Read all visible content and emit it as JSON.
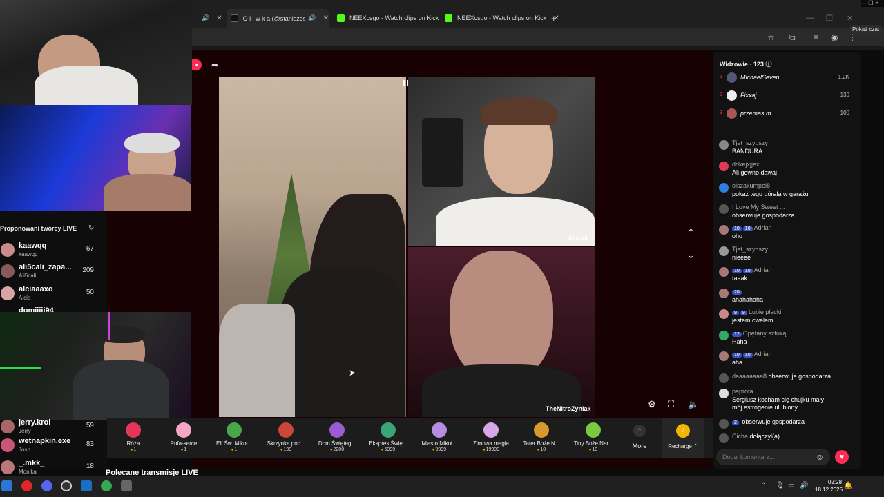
{
  "browser": {
    "tabs": [
      {
        "label": "O l i w k a (@staniszesia_)",
        "active": true
      },
      {
        "label": "NEEXcsgo - Watch clips on Kick",
        "active": false
      },
      {
        "label": "NEEXcsgo - Watch clips on Kick",
        "active": false
      }
    ],
    "show_chat_tooltip": "Pokaż czat"
  },
  "sidebar": {
    "title": "Proponowani twórcy LIVE",
    "creators": [
      {
        "name": "kaawqq",
        "sub": "kaawqq",
        "count": "67"
      },
      {
        "name": "ali5cali_zapa...",
        "sub": "Ali5cali",
        "count": "209"
      },
      {
        "name": "alciaaaxo",
        "sub": "Alcia",
        "count": "50"
      },
      {
        "name": "domiiiii94",
        "sub": "",
        "count": ""
      },
      {
        "name": "jerry.krol",
        "sub": "Jerry",
        "count": "59"
      },
      {
        "name": "wetnapkin.exe",
        "sub": "Josh",
        "count": "83"
      },
      {
        "name": "_.mkk_",
        "sub": "Monika",
        "count": "18"
      }
    ]
  },
  "video": {
    "tr_label": "Aliscali",
    "br_label": "TheNitroZyniak"
  },
  "gifts": [
    {
      "name": "Róża",
      "price": "1",
      "color": "#e7345a"
    },
    {
      "name": "Pufa-serce",
      "price": "1",
      "color": "#f4a7c6"
    },
    {
      "name": "Elf Św. Mikoł...",
      "price": "1",
      "color": "#49a649"
    },
    {
      "name": "Skrzynka poc...",
      "price": "199",
      "color": "#c9483a"
    },
    {
      "name": "Dom Święteg...",
      "price": "2200",
      "color": "#9b5bd4"
    },
    {
      "name": "Ekspres Świę...",
      "price": "5999",
      "color": "#3aa577"
    },
    {
      "name": "Miasto Mikoł...",
      "price": "9999",
      "color": "#b68de0"
    },
    {
      "name": "Zimowa magia",
      "price": "19999",
      "color": "#d8a7e8"
    },
    {
      "name": "Tater Boże N...",
      "price": "10",
      "color": "#d89a2e"
    },
    {
      "name": "Tiny Boże Nar...",
      "price": "10",
      "color": "#7ac943"
    }
  ],
  "controls": {
    "more": "More",
    "recharge": "Recharge"
  },
  "recommended_title": "Polecane transmisje LIVE",
  "chat": {
    "viewers_title": "Widzowie · 123",
    "top_viewers": [
      {
        "rank": "1",
        "name": "MichaelSeven",
        "score": "1.2K"
      },
      {
        "rank": "2",
        "name": "Fixxaj",
        "score": "139"
      },
      {
        "rank": "3",
        "name": "przemas.m",
        "score": "100"
      }
    ],
    "messages": [
      {
        "user": "Tjet_szybszy",
        "badges": [],
        "text": "BANDURA"
      },
      {
        "user": "ddkejxjjex",
        "badges": [],
        "text": "Ali gowno dawaj"
      },
      {
        "user": "olszakumpel8",
        "badges": [],
        "text": "pokaż tego górala w garażu"
      },
      {
        "user": "I Love My Sweet ...",
        "badges": [],
        "text": "obserwuje gospodarza"
      },
      {
        "user": "Adrian",
        "badges": [
          "10",
          "10"
        ],
        "text": "oho"
      },
      {
        "user": "Tjet_szybszy",
        "badges": [],
        "text": "nieeee"
      },
      {
        "user": "Adrian",
        "badges": [
          "10",
          "10"
        ],
        "text": "taaak"
      },
      {
        "user": "",
        "badges": [
          "20"
        ],
        "text": "ahahahaha"
      },
      {
        "user": "Lubie placki",
        "badges": [
          "9",
          "9"
        ],
        "text": "jestem cwelem"
      },
      {
        "user": "Opętany sztuką",
        "badges": [
          "12"
        ],
        "text": "Haha"
      },
      {
        "user": "Adrian",
        "badges": [
          "10",
          "10"
        ],
        "text": "aha"
      },
      {
        "user": "daaaaaaaa8",
        "badges": [],
        "text": "obserwuje gospodarza",
        "inline": true
      },
      {
        "user": "paprota",
        "badges": [],
        "text": "Sergiusz kocham cię chujku mały",
        "text2": "mój estrogenie ulubiony"
      },
      {
        "user": "",
        "badges": [
          "2"
        ],
        "text": "obserwuje gospodarza",
        "inline": true
      },
      {
        "user": "Cicha",
        "badges": [],
        "text": "dołączył(a)",
        "inline": true
      }
    ],
    "comment_placeholder": "Dodaj komentarz..."
  },
  "taskbar": {
    "time": "02:28",
    "date": "18.12.2025"
  }
}
